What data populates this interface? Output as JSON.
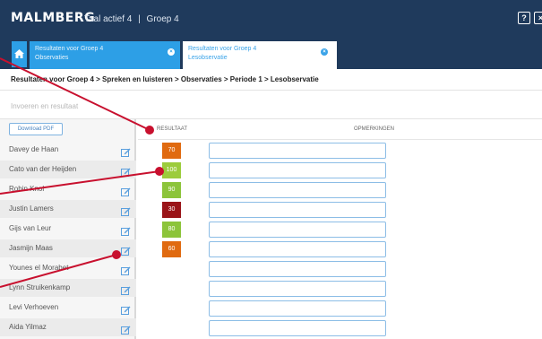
{
  "app": {
    "brand": "MALMBERG",
    "section": "Taal actief 4",
    "separator": "|",
    "group": "Groep 4",
    "help_label": "?",
    "close_label": "×"
  },
  "tabs": [
    {
      "line1": "Resultaten voor Groep 4",
      "line2": "Observaties",
      "close": "×"
    },
    {
      "line1": "Resultaten voor Groep 4",
      "line2": "Lesobservatie",
      "close": "×"
    }
  ],
  "breadcrumb": "Resultaten voor Groep 4 > Spreken en luisteren > Observaties > Periode 1 > Lesobservatie",
  "instruction": "Invoeren en resultaat",
  "download_label": "Download PDF",
  "columns": {
    "result": "RESULTAAT",
    "remarks": "OPMERKINGEN"
  },
  "students": [
    {
      "name": "Davey de Haan",
      "result": "70",
      "color": "#e06a10",
      "remark": ""
    },
    {
      "name": "Cato van der Heijden",
      "result": "100",
      "color": "#9ccc3c",
      "remark": ""
    },
    {
      "name": "Robin Knol",
      "result": "90",
      "color": "#8cc43a",
      "remark": ""
    },
    {
      "name": "Justin Lamers",
      "result": "30",
      "color": "#9a1418",
      "remark": ""
    },
    {
      "name": "Gijs van Leur",
      "result": "80",
      "color": "#8cc43a",
      "remark": ""
    },
    {
      "name": "Jasmijn Maas",
      "result": "60",
      "color": "#e06a10",
      "remark": ""
    },
    {
      "name": "Younes el Morabet",
      "result": "",
      "color": "",
      "remark": ""
    },
    {
      "name": "Lynn Struikenkamp",
      "result": "",
      "color": "",
      "remark": ""
    },
    {
      "name": "Levi Verhoeven",
      "result": "",
      "color": "",
      "remark": ""
    },
    {
      "name": "Aida Yilmaz",
      "result": "",
      "color": "",
      "remark": ""
    }
  ],
  "icons": {
    "home": "home-icon",
    "edit": "edit-icon",
    "help": "help-icon",
    "close": "close-icon"
  },
  "colors": {
    "header": "#1f3a5c",
    "active_tab": "#2d9fe6",
    "annotation": "#c8102e"
  }
}
